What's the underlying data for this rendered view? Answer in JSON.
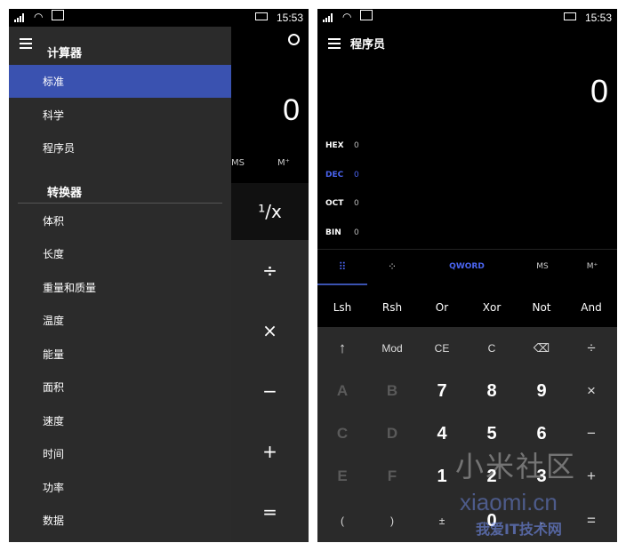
{
  "status": {
    "time": "15:53"
  },
  "left": {
    "display": "0",
    "mem_ms": "MS",
    "mem_mplus": "M⁺",
    "keys": [
      "¹/x",
      "÷",
      "×",
      "−",
      "+",
      "="
    ],
    "drawer": {
      "calc_heading": "计算器",
      "calc_items": [
        "标准",
        "科学",
        "程序员"
      ],
      "conv_heading": "转换器",
      "conv_items": [
        "体积",
        "长度",
        "重量和质量",
        "温度",
        "能量",
        "面积",
        "速度",
        "时间",
        "功率",
        "数据"
      ]
    }
  },
  "right": {
    "title": "程序员",
    "display": "0",
    "bases": [
      {
        "label": "HEX",
        "value": "0"
      },
      {
        "label": "DEC",
        "value": "0"
      },
      {
        "label": "OCT",
        "value": "0"
      },
      {
        "label": "BIN",
        "value": "0"
      }
    ],
    "toolbar": {
      "word": "QWORD",
      "ms": "MS",
      "mplus": "M⁺"
    },
    "ops": [
      "Lsh",
      "Rsh",
      "Or",
      "Xor",
      "Not",
      "And"
    ],
    "keypad": [
      [
        "↑",
        "Mod",
        "CE",
        "C",
        "⌫",
        "÷"
      ],
      [
        "A",
        "B",
        "7",
        "8",
        "9",
        "×"
      ],
      [
        "C",
        "D",
        "4",
        "5",
        "6",
        "−"
      ],
      [
        "E",
        "F",
        "1",
        "2",
        "3",
        "+"
      ],
      [
        "(",
        ")",
        "±",
        "0",
        ".",
        "="
      ]
    ]
  },
  "watermark": {
    "line1": "小米社区",
    "line2": "xiaomi.cn",
    "line3": "我爱IT技术网"
  },
  "colors": {
    "accent": "#3a52b0",
    "accent_text": "#4a64f0",
    "drawer_bg": "#2b2b2b",
    "keypad_bg": "#2a2a2a"
  }
}
